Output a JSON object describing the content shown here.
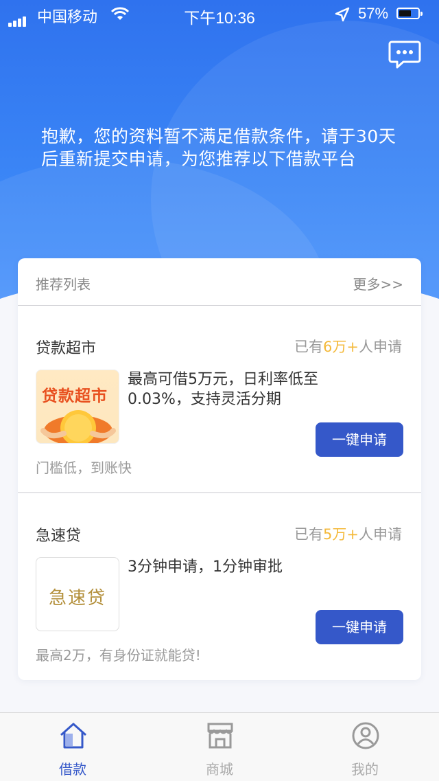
{
  "status_bar": {
    "carrier": "中国移动",
    "time": "下午10:36",
    "battery_percent": "57%"
  },
  "header": {
    "notice": "抱歉，您的资料暂不满足借款条件，请于30天后重新提交申请，为您推荐以下借款平台"
  },
  "list": {
    "title": "推荐列表",
    "more": "更多>>",
    "items": [
      {
        "name": "贷款超市",
        "count_prefix": "已有",
        "count_value": "6万+",
        "count_suffix": "人申请",
        "logo_text": "贷款超市",
        "description": "最高可借5万元，日利率低至0.03%，支持灵活分期",
        "button": "一键申请",
        "sub": "门槛低，到账快"
      },
      {
        "name": "急速贷",
        "count_prefix": "已有",
        "count_value": "5万+",
        "count_suffix": "人申请",
        "logo_text": "急速贷",
        "description": "3分钟申请，1分钟审批",
        "button": "一键申请",
        "sub": "最高2万，有身份证就能贷!"
      }
    ]
  },
  "tabbar": {
    "tabs": [
      {
        "label": "借款",
        "icon": "home-icon",
        "active": true
      },
      {
        "label": "商城",
        "icon": "store-icon",
        "active": false
      },
      {
        "label": "我的",
        "icon": "profile-icon",
        "active": false
      }
    ]
  },
  "colors": {
    "brand_blue": "#3558c9",
    "header_blue": "#2f72ee",
    "highlight": "#f4b93a"
  }
}
